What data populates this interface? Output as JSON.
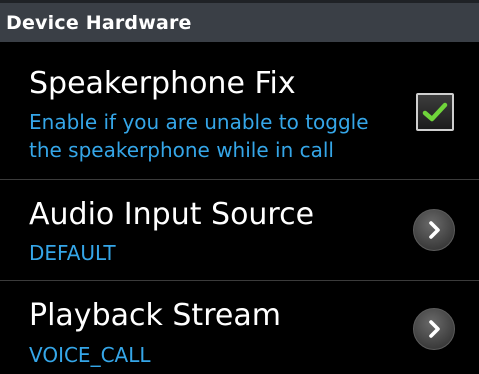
{
  "category": {
    "title": "Device Hardware"
  },
  "preferences": [
    {
      "title": "Speakerphone Fix",
      "summary_line1": "Enable if you are unable to toggle",
      "summary_line2": "the speakerphone while in call",
      "widget": "checkbox",
      "checked": true,
      "icon": "checkmark-icon"
    },
    {
      "title": "Audio Input Source",
      "summary": "DEFAULT",
      "widget": "chevron",
      "icon": "chevron-right-icon"
    },
    {
      "title": "Playback Stream",
      "summary": "VOICE_CALL",
      "widget": "chevron",
      "icon": "chevron-right-icon"
    }
  ],
  "colors": {
    "header_background": "#3a3f46",
    "summary_text": "#35a6e8",
    "checkmark": "#6fd43a"
  }
}
